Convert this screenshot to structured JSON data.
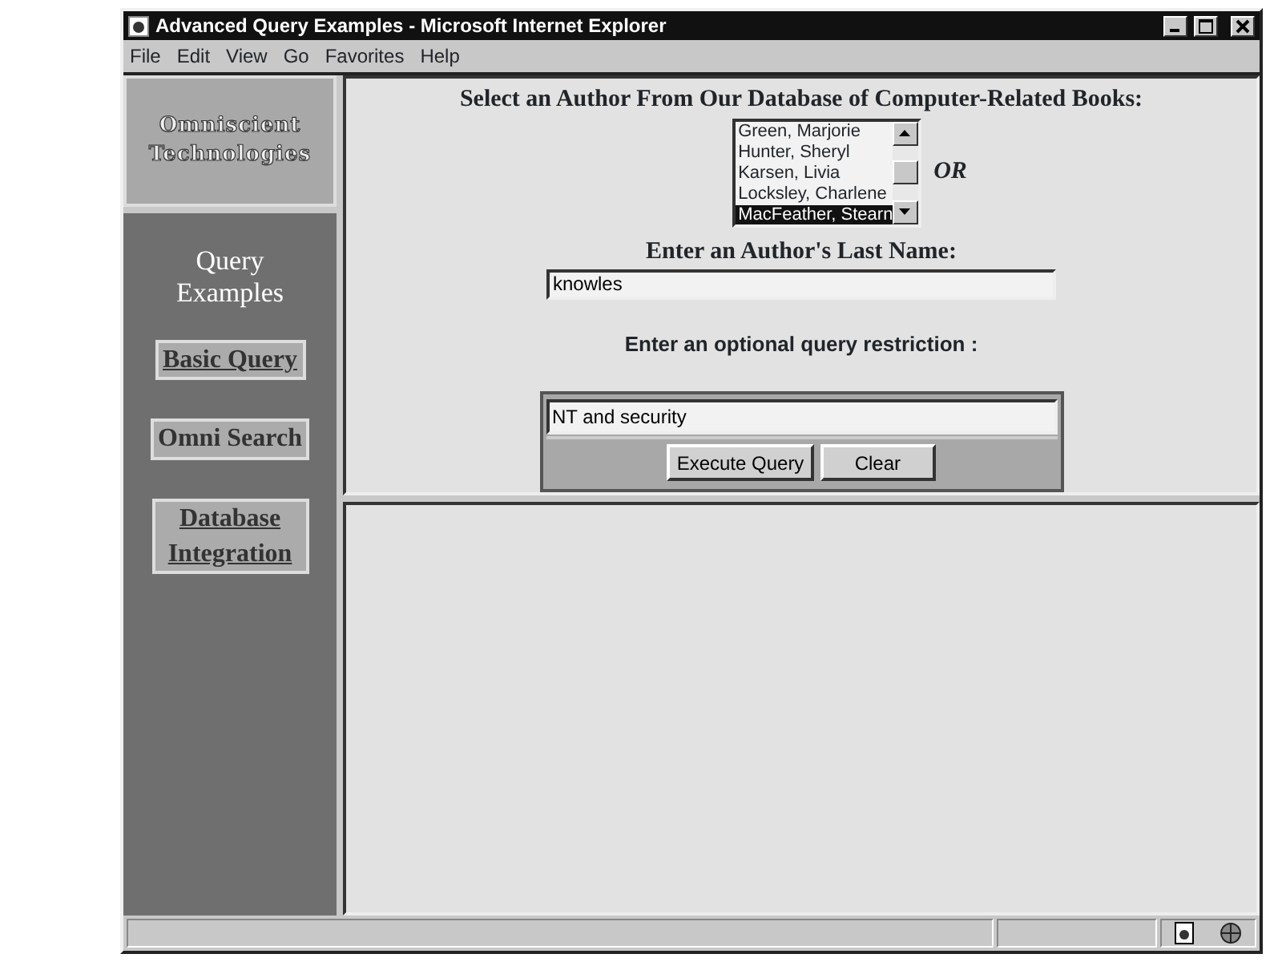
{
  "window": {
    "title": "Advanced Query Examples - Microsoft Internet Explorer"
  },
  "menu": [
    "File",
    "Edit",
    "View",
    "Go",
    "Favorites",
    "Help"
  ],
  "sidebar": {
    "logo": [
      "Omniscient",
      "Technologies"
    ],
    "heading": "Query Examples",
    "links": [
      {
        "label": "Basic Query",
        "selected": false
      },
      {
        "label": "Omni Search",
        "selected": true
      },
      {
        "label": "Database Integration",
        "selected": false
      }
    ]
  },
  "form": {
    "author_prompt": "Select an Author From Our Database of Computer-Related Books:",
    "authors": [
      {
        "name": "Green, Marjorie",
        "selected": false
      },
      {
        "name": "Hunter, Sheryl",
        "selected": false
      },
      {
        "name": "Karsen, Livia",
        "selected": false
      },
      {
        "name": "Locksley, Charlene",
        "selected": false
      },
      {
        "name": "MacFeather, Stearn",
        "selected": true
      }
    ],
    "or_label": "OR",
    "last_name_label": "Enter an Author's Last Name:",
    "last_name_value": "knowles",
    "restriction_label": "Enter an optional query restriction :",
    "restriction_value": "NT and security",
    "buttons": [
      "Execute Query",
      "Clear"
    ]
  }
}
